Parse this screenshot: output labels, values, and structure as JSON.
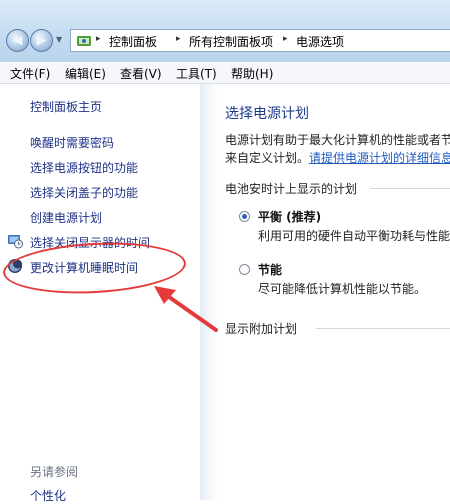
{
  "nav": {
    "back_glyph": "◀",
    "forward_glyph": "▶",
    "dropdown_glyph": "▼",
    "breadcrumb_sep": "▸",
    "breadcrumb": [
      "控制面板",
      "所有控制面板项",
      "电源选项"
    ]
  },
  "menu": {
    "items": [
      "文件(F)",
      "编辑(E)",
      "查看(V)",
      "工具(T)",
      "帮助(H)"
    ]
  },
  "left": {
    "home": "控制面板主页",
    "tasks": [
      "唤醒时需要密码",
      "选择电源按钮的功能",
      "选择关闭盖子的功能",
      "创建电源计划",
      "选择关闭显示器的时间",
      "更改计算机睡眠时间"
    ],
    "see_also": "另请参阅",
    "see_also_items": [
      "个性化"
    ]
  },
  "main": {
    "title": "选择电源计划",
    "desc_line1": "电源计划有助于最大化计算机的性能或者节",
    "desc_line2_prefix": "来自定义计划。",
    "desc_link": "请提供电源计划的详细信息",
    "battery_section": "电池安时计上显示的计划",
    "plans": [
      {
        "name": "平衡 (推荐)",
        "desc": "利用可用的硬件自动平衡功耗与性能",
        "selected": true
      },
      {
        "name": "节能",
        "desc": "尽可能降低计算机性能以节能。",
        "selected": false
      }
    ],
    "additional_section": "显示附加计划"
  },
  "annotation": {
    "color": "#e53a3a"
  },
  "colors": {
    "link": "#1e3287",
    "title": "#1e3c8c",
    "addressbar": "#c5dcf1"
  }
}
